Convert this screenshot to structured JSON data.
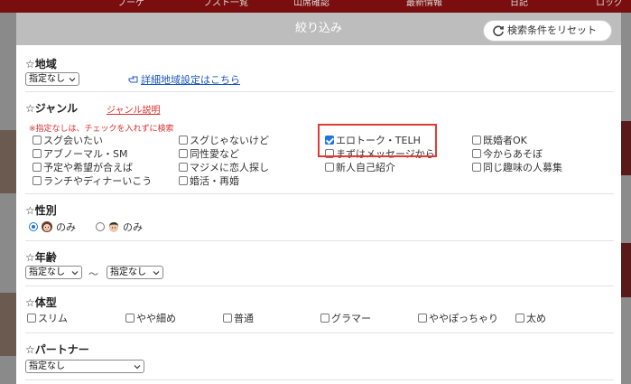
{
  "background": {
    "nav_items": [
      "ブーゲ",
      "ブスト一覧",
      "山席確認",
      "最新情報",
      "日記",
      "ロッグ"
    ]
  },
  "modal": {
    "title": "絞り込み",
    "reset_button": "検索条件をリセット"
  },
  "region": {
    "title": "☆地域",
    "select_value": "指定なし",
    "detail_link": "詳細地域設定はこちら"
  },
  "genre": {
    "title": "☆ジャンル",
    "help_link": "ジャンル説明",
    "note": "※指定なしは、チェックを入れずに検索",
    "options": [
      {
        "label": "スグ会いたい",
        "checked": false
      },
      {
        "label": "スグじゃないけど",
        "checked": false
      },
      {
        "label": "エロトーク・TELH",
        "checked": true
      },
      {
        "label": "既婚者OK",
        "checked": false
      },
      {
        "label": "アブノーマル・SM",
        "checked": false
      },
      {
        "label": "同性愛など",
        "checked": false
      },
      {
        "label": "まずはメッセージから",
        "checked": false
      },
      {
        "label": "今からあそぼ",
        "checked": false
      },
      {
        "label": "予定や希望が合えば",
        "checked": false
      },
      {
        "label": "マジメに恋人探し",
        "checked": false
      },
      {
        "label": "新人自己紹介",
        "checked": false
      },
      {
        "label": "同じ趣味の人募集",
        "checked": false
      },
      {
        "label": "ランチやディナーいこう",
        "checked": false
      },
      {
        "label": "婚活・再婚",
        "checked": false
      }
    ]
  },
  "gender": {
    "title": "☆性別",
    "options": [
      {
        "label": "のみ",
        "selected": true,
        "icon": "female-face-icon"
      },
      {
        "label": "のみ",
        "selected": false,
        "icon": "male-face-icon"
      }
    ]
  },
  "age": {
    "title": "☆年齢",
    "from": "指定なし",
    "separator": "〜",
    "to": "指定なし"
  },
  "body_type": {
    "title": "☆体型",
    "options": [
      {
        "label": "スリム",
        "checked": false
      },
      {
        "label": "やや細め",
        "checked": false
      },
      {
        "label": "普通",
        "checked": false
      },
      {
        "label": "グラマー",
        "checked": false
      },
      {
        "label": "ややぽっちゃり",
        "checked": false
      },
      {
        "label": "太め",
        "checked": false
      }
    ]
  },
  "partner": {
    "title": "☆パートナー",
    "select_value": "指定なし"
  },
  "colors": {
    "header_bg": "#bdbdbd",
    "link_blue": "#1a56b8",
    "note_red": "#d93030",
    "highlight_red": "#e53935",
    "check_blue": "#1a73e8"
  }
}
